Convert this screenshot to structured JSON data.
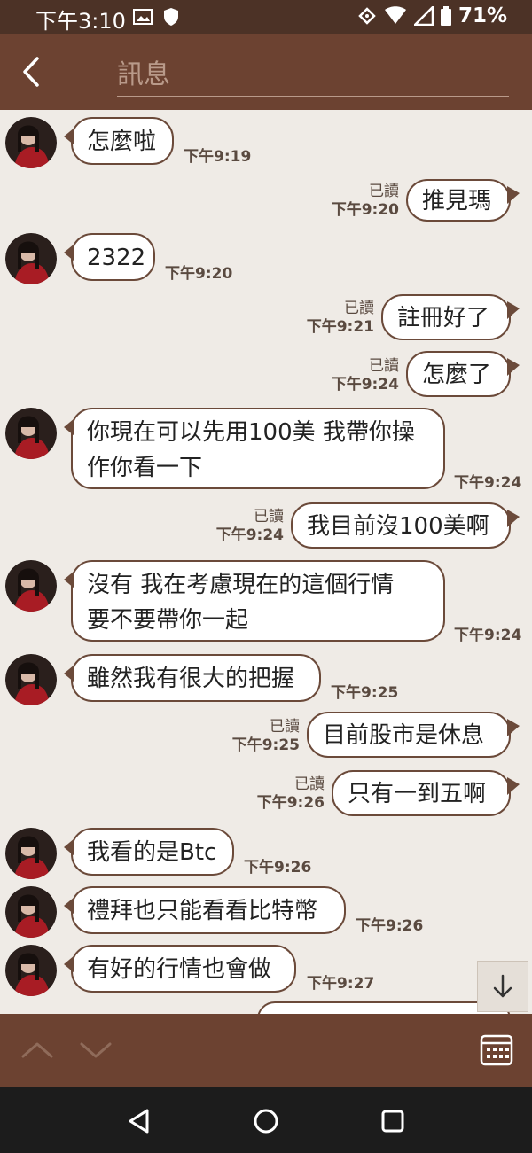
{
  "status_bar": {
    "time": "下午3:10",
    "battery": "71%",
    "icons": [
      "image-icon",
      "shield-icon",
      "sync-icon",
      "wifi-icon",
      "signal-icon",
      "battery-icon"
    ]
  },
  "header": {
    "search_placeholder": "訊息",
    "back_icon": "chevron-left-icon"
  },
  "messages": [
    {
      "dir": "in",
      "text": "怎麼啦",
      "time": "下午9:19"
    },
    {
      "dir": "out",
      "text": "推見瑪",
      "read": "已讀",
      "time": "下午9:20"
    },
    {
      "dir": "in",
      "text": "2322",
      "time": "下午9:20"
    },
    {
      "dir": "out",
      "text": "註冊好了",
      "read": "已讀",
      "time": "下午9:21"
    },
    {
      "dir": "out",
      "text": "怎麼了",
      "read": "已讀",
      "time": "下午9:24"
    },
    {
      "dir": "in",
      "text": "你現在可以先用100美 我帶你操\n作你看一下",
      "time": "下午9:24"
    },
    {
      "dir": "out",
      "text": "我目前沒100美啊",
      "read": "已讀",
      "time": "下午9:24"
    },
    {
      "dir": "in",
      "text": "沒有 我在考慮現在的這個行情\n要不要帶你一起",
      "time": "下午9:24"
    },
    {
      "dir": "in",
      "text": "雖然我有很大的把握",
      "time": "下午9:25"
    },
    {
      "dir": "out",
      "text": "目前股市是休息",
      "read": "已讀",
      "time": "下午9:25"
    },
    {
      "dir": "out",
      "text": "只有一到五啊",
      "read": "已讀",
      "time": "下午9:26"
    },
    {
      "dir": "in",
      "text": "我看的是Btc",
      "time": "下午9:26"
    },
    {
      "dir": "in",
      "text": "禮拜也只能看看比特幣",
      "time": "下午9:26"
    },
    {
      "dir": "in",
      "text": "有好的行情也會做",
      "time": "下午9:27"
    }
  ],
  "bottom_bar": {
    "icons": [
      "chevron-up-icon",
      "chevron-down-icon",
      "calendar-icon"
    ]
  },
  "system_nav": {
    "icons": [
      "back-triangle-icon",
      "home-circle-icon",
      "recents-square-icon"
    ]
  },
  "colors": {
    "status_bar": "#4c3226",
    "app_bar": "#6c4231",
    "chat_bg": "#efebe6",
    "bubble_border": "#6b4a3a",
    "nav_bar": "#1c1c1c"
  }
}
